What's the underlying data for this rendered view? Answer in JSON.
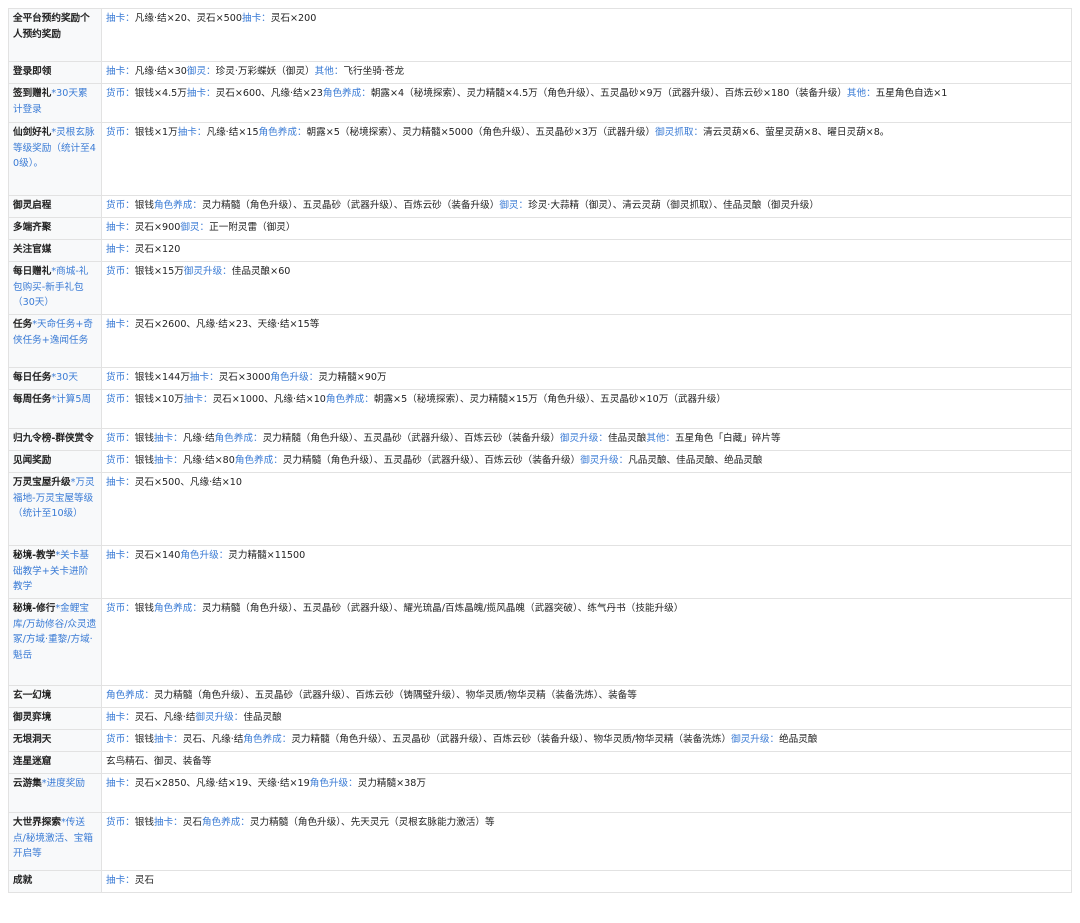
{
  "rows": [
    {
      "name": "全平台预约奖励个人预约奖励",
      "note": "",
      "parts": [
        {
          "t": "抽卡：",
          "b": true
        },
        {
          "t": "凡缘·结×20、灵石×500",
          "b": false
        },
        {
          "t": "抽卡：",
          "b": true
        },
        {
          "t": "灵石×200",
          "b": false
        }
      ]
    },
    {
      "name": "登录即领",
      "note": "",
      "parts": [
        {
          "t": "抽卡：",
          "b": true
        },
        {
          "t": "凡缘·结×30",
          "b": false
        },
        {
          "t": "御灵：",
          "b": true
        },
        {
          "t": "珍灵·万彩蝶妖（御灵）",
          "b": false
        },
        {
          "t": "其他：",
          "b": true
        },
        {
          "t": "飞行坐骑·苍龙",
          "b": false
        }
      ]
    },
    {
      "name": "签到赠礼",
      "note": "*30天累计登录",
      "parts": [
        {
          "t": "货币：",
          "b": true
        },
        {
          "t": "银钱×4.5万",
          "b": false
        },
        {
          "t": "抽卡：",
          "b": true
        },
        {
          "t": "灵石×600、凡缘·结×23",
          "b": false
        },
        {
          "t": "角色养成：",
          "b": true
        },
        {
          "t": "朝露×4（秘境探索）、灵力精髓×4.5万（角色升级）、五灵晶砂×9万（武器升级）、百炼云砂×180（装备升级）",
          "b": false
        },
        {
          "t": "其他：",
          "b": true
        },
        {
          "t": "五星角色自选×1",
          "b": false
        }
      ]
    },
    {
      "name": "仙剑好礼",
      "note": "*灵根玄脉等级奖励（统计至40级）。",
      "parts": [
        {
          "t": "货币：",
          "b": true
        },
        {
          "t": "银钱×1万",
          "b": false
        },
        {
          "t": "抽卡：",
          "b": true
        },
        {
          "t": "凡缘·结×15",
          "b": false
        },
        {
          "t": "角色养成：",
          "b": true
        },
        {
          "t": "朝露×5（秘境探索）、灵力精髓×5000（角色升级）、五灵晶砂×3万（武器升级）",
          "b": false
        },
        {
          "t": "御灵抓取：",
          "b": true
        },
        {
          "t": "清云灵葫×6、萤星灵葫×8、曜日灵葫×8。",
          "b": false
        }
      ]
    },
    {
      "name": "御灵启程",
      "note": "",
      "parts": [
        {
          "t": "货币：",
          "b": true
        },
        {
          "t": "银钱",
          "b": false
        },
        {
          "t": "角色养成：",
          "b": true
        },
        {
          "t": "灵力精髓（角色升级）、五灵晶砂（武器升级）、百炼云砂（装备升级）",
          "b": false
        },
        {
          "t": "御灵：",
          "b": true
        },
        {
          "t": "珍灵·大蒜精（御灵）、清云灵葫（御灵抓取）、佳品灵酿（御灵升级）",
          "b": false
        }
      ]
    },
    {
      "name": "多端齐聚",
      "note": "",
      "parts": [
        {
          "t": "抽卡：",
          "b": true
        },
        {
          "t": "灵石×900",
          "b": false
        },
        {
          "t": "御灵：",
          "b": true
        },
        {
          "t": "正一附灵雷（御灵）",
          "b": false
        }
      ]
    },
    {
      "name": "关注官媒",
      "note": "",
      "parts": [
        {
          "t": "抽卡：",
          "b": true
        },
        {
          "t": "灵石×120",
          "b": false
        }
      ]
    },
    {
      "name": "每日赠礼",
      "note": "*商城-礼包购买-新手礼包（30天）",
      "parts": [
        {
          "t": "货币：",
          "b": true
        },
        {
          "t": "银钱×15万",
          "b": false
        },
        {
          "t": "御灵升级：",
          "b": true
        },
        {
          "t": "佳品灵酿×60",
          "b": false
        }
      ]
    },
    {
      "name": "任务",
      "note": "*天命任务+奇侠任务+逸闻任务",
      "parts": [
        {
          "t": "抽卡：",
          "b": true
        },
        {
          "t": "灵石×2600、凡缘·结×23、天缘·结×15等",
          "b": false
        }
      ]
    },
    {
      "name": "每日任务",
      "note": "*30天",
      "parts": [
        {
          "t": "货币：",
          "b": true
        },
        {
          "t": "银钱×144万",
          "b": false
        },
        {
          "t": "抽卡：",
          "b": true
        },
        {
          "t": "灵石×3000",
          "b": false
        },
        {
          "t": "角色升级：",
          "b": true
        },
        {
          "t": "灵力精髓×90万",
          "b": false
        }
      ]
    },
    {
      "name": "每周任务",
      "note": "*计算5周",
      "parts": [
        {
          "t": "货币：",
          "b": true
        },
        {
          "t": "银钱×10万",
          "b": false
        },
        {
          "t": "抽卡：",
          "b": true
        },
        {
          "t": "灵石×1000、凡缘·结×10",
          "b": false
        },
        {
          "t": "角色养成：",
          "b": true
        },
        {
          "t": "朝露×5（秘境探索）、灵力精髓×15万（角色升级）、五灵晶砂×10万（武器升级）",
          "b": false
        }
      ]
    },
    {
      "name": "归九令榜-群侠赏令",
      "note": "",
      "parts": [
        {
          "t": "货币：",
          "b": true
        },
        {
          "t": "银钱",
          "b": false
        },
        {
          "t": "抽卡：",
          "b": true
        },
        {
          "t": "凡缘·结",
          "b": false
        },
        {
          "t": "角色养成：",
          "b": true
        },
        {
          "t": "灵力精髓（角色升级）、五灵晶砂（武器升级）、百炼云砂（装备升级）",
          "b": false
        },
        {
          "t": "御灵升级：",
          "b": true
        },
        {
          "t": "佳品灵酿",
          "b": false
        },
        {
          "t": "其他：",
          "b": true
        },
        {
          "t": "五星角色「白藏」碎片等",
          "b": false
        }
      ]
    },
    {
      "name": "见闻奖励",
      "note": "",
      "parts": [
        {
          "t": "货币：",
          "b": true
        },
        {
          "t": "银钱",
          "b": false
        },
        {
          "t": "抽卡：",
          "b": true
        },
        {
          "t": "凡缘·结×80",
          "b": false
        },
        {
          "t": "角色养成：",
          "b": true
        },
        {
          "t": "灵力精髓（角色升级）、五灵晶砂（武器升级）、百炼云砂（装备升级）",
          "b": false
        },
        {
          "t": "御灵升级：",
          "b": true
        },
        {
          "t": "凡品灵酿、佳品灵酿、绝品灵酿",
          "b": false
        }
      ]
    },
    {
      "name": "万灵宝屋升级",
      "note": "*万灵福地-万灵宝屋等级（统计至10级）",
      "parts": [
        {
          "t": "抽卡：",
          "b": true
        },
        {
          "t": "灵石×500、凡缘·结×10",
          "b": false
        }
      ]
    },
    {
      "name": "秘境-教学",
      "note": "*关卡基础教学+关卡进阶教学",
      "parts": [
        {
          "t": "抽卡：",
          "b": true
        },
        {
          "t": "灵石×140",
          "b": false
        },
        {
          "t": "角色升级：",
          "b": true
        },
        {
          "t": "灵力精髓×11500",
          "b": false
        }
      ]
    },
    {
      "name": "秘境-修行",
      "note": "*金鲤宝库/万劫修谷/众灵遗冢/方域·重黎/方域·魁岳",
      "parts": [
        {
          "t": "货币：",
          "b": true
        },
        {
          "t": "银钱",
          "b": false
        },
        {
          "t": "角色养成：",
          "b": true
        },
        {
          "t": "灵力精髓（角色升级）、五灵晶砂（武器升级）、耀光琉晶/百炼晶魄/揽风晶魄（武器突破）、练气丹书（技能升级）",
          "b": false
        }
      ]
    },
    {
      "name": "玄一幻境",
      "note": "",
      "parts": [
        {
          "t": "角色养成：",
          "b": true
        },
        {
          "t": "灵力精髓（角色升级）、五灵晶砂（武器升级）、百炼云砂（铸隅璧升级）、物华灵质/物华灵精（装备洗炼）、装备等",
          "b": false
        }
      ]
    },
    {
      "name": "御灵弈境",
      "note": "",
      "parts": [
        {
          "t": "抽卡：",
          "b": true
        },
        {
          "t": "灵石、凡缘·结",
          "b": false
        },
        {
          "t": "御灵升级：",
          "b": true
        },
        {
          "t": "佳品灵酿",
          "b": false
        }
      ]
    },
    {
      "name": "无垠洞天",
      "note": "",
      "parts": [
        {
          "t": "货币：",
          "b": true
        },
        {
          "t": "银钱",
          "b": false
        },
        {
          "t": "抽卡：",
          "b": true
        },
        {
          "t": "灵石、凡缘·结",
          "b": false
        },
        {
          "t": "角色养成：",
          "b": true
        },
        {
          "t": "灵力精髓（角色升级）、五灵晶砂（武器升级）、百炼云砂（装备升级）、物华灵质/物华灵精（装备洗炼）",
          "b": false
        },
        {
          "t": "御灵升级：",
          "b": true
        },
        {
          "t": "绝品灵酿",
          "b": false
        }
      ]
    },
    {
      "name": "连星迷窟",
      "note": "",
      "parts": [
        {
          "t": "玄鸟精石、御灵、装备等",
          "b": false
        }
      ]
    },
    {
      "name": "云游集",
      "note": "*进度奖励",
      "parts": [
        {
          "t": "抽卡：",
          "b": true
        },
        {
          "t": "灵石×2850、凡缘·结×19、天缘·结×19",
          "b": false
        },
        {
          "t": "角色升级：",
          "b": true
        },
        {
          "t": "灵力精髓×38万",
          "b": false
        }
      ]
    },
    {
      "name": "大世界探索",
      "note": "*传送点/秘境激活、宝箱开启等",
      "parts": [
        {
          "t": "货币：",
          "b": true
        },
        {
          "t": "银钱",
          "b": false
        },
        {
          "t": "抽卡：",
          "b": true
        },
        {
          "t": "灵石",
          "b": false
        },
        {
          "t": "角色养成：",
          "b": true
        },
        {
          "t": "灵力精髓（角色升级）、先天灵元（灵根玄脉能力激活）等",
          "b": false
        }
      ]
    },
    {
      "name": "成就",
      "note": "",
      "parts": [
        {
          "t": "抽卡：",
          "b": true
        },
        {
          "t": "灵石",
          "b": false
        }
      ]
    }
  ]
}
